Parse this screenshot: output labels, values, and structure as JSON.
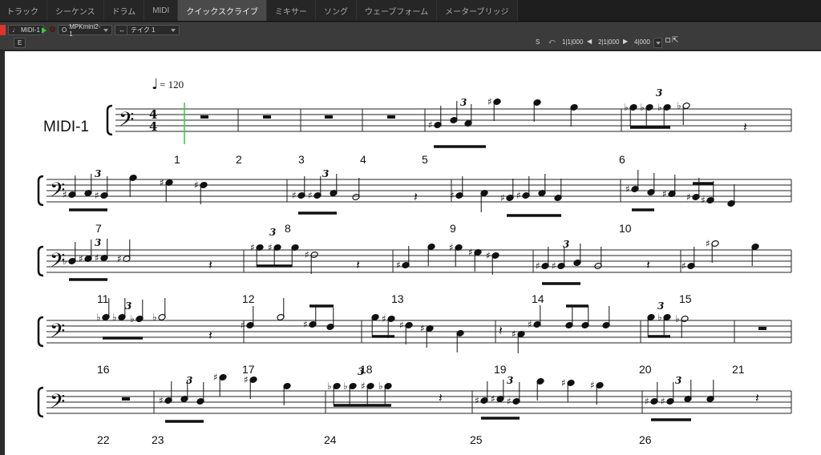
{
  "tabs": [
    {
      "label": "トラック",
      "active": false
    },
    {
      "label": "シーケンス",
      "active": false
    },
    {
      "label": "ドラム",
      "active": false
    },
    {
      "label": "MIDI",
      "active": false
    },
    {
      "label": "クイックスクライブ",
      "active": true
    },
    {
      "label": "ミキサー",
      "active": false
    },
    {
      "label": "ソング",
      "active": false
    },
    {
      "label": "ウェーブフォーム",
      "active": false
    },
    {
      "label": "メーターブリッジ",
      "active": false
    }
  ],
  "toolbar": {
    "track_select": "MIDI-1",
    "input_device": "MPKmini2-1",
    "take_select": "テイク 1",
    "e_button": "E",
    "s_button": "S",
    "position_start": "1|1|000",
    "position_end": "2|1|000",
    "length": "4|000"
  },
  "score": {
    "track_name": "MIDI-1",
    "tempo_text": "= 120",
    "time_signature_top": "4",
    "time_signature_bottom": "4",
    "clef": "bass",
    "triplet_mark": "3",
    "systems": [
      {
        "measure_numbers": [
          "1",
          "2",
          "3",
          "4",
          "5",
          "6"
        ]
      },
      {
        "measure_numbers": [
          "7",
          "8",
          "9",
          "10"
        ]
      },
      {
        "measure_numbers": [
          "11",
          "12",
          "13",
          "14",
          "15"
        ]
      },
      {
        "measure_numbers": [
          "16",
          "17",
          "18",
          "19",
          "20",
          "21"
        ]
      },
      {
        "measure_numbers": [
          "22",
          "23",
          "24",
          "25",
          "26"
        ]
      }
    ]
  }
}
